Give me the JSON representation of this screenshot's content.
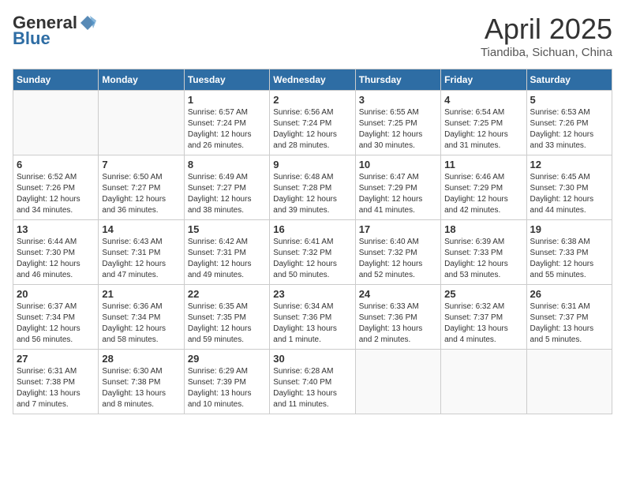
{
  "logo": {
    "general": "General",
    "blue": "Blue"
  },
  "header": {
    "month": "April 2025",
    "location": "Tiandiba, Sichuan, China"
  },
  "days_of_week": [
    "Sunday",
    "Monday",
    "Tuesday",
    "Wednesday",
    "Thursday",
    "Friday",
    "Saturday"
  ],
  "weeks": [
    [
      {
        "day": "",
        "detail": ""
      },
      {
        "day": "",
        "detail": ""
      },
      {
        "day": "1",
        "detail": "Sunrise: 6:57 AM\nSunset: 7:24 PM\nDaylight: 12 hours and 26 minutes."
      },
      {
        "day": "2",
        "detail": "Sunrise: 6:56 AM\nSunset: 7:24 PM\nDaylight: 12 hours and 28 minutes."
      },
      {
        "day": "3",
        "detail": "Sunrise: 6:55 AM\nSunset: 7:25 PM\nDaylight: 12 hours and 30 minutes."
      },
      {
        "day": "4",
        "detail": "Sunrise: 6:54 AM\nSunset: 7:25 PM\nDaylight: 12 hours and 31 minutes."
      },
      {
        "day": "5",
        "detail": "Sunrise: 6:53 AM\nSunset: 7:26 PM\nDaylight: 12 hours and 33 minutes."
      }
    ],
    [
      {
        "day": "6",
        "detail": "Sunrise: 6:52 AM\nSunset: 7:26 PM\nDaylight: 12 hours and 34 minutes."
      },
      {
        "day": "7",
        "detail": "Sunrise: 6:50 AM\nSunset: 7:27 PM\nDaylight: 12 hours and 36 minutes."
      },
      {
        "day": "8",
        "detail": "Sunrise: 6:49 AM\nSunset: 7:27 PM\nDaylight: 12 hours and 38 minutes."
      },
      {
        "day": "9",
        "detail": "Sunrise: 6:48 AM\nSunset: 7:28 PM\nDaylight: 12 hours and 39 minutes."
      },
      {
        "day": "10",
        "detail": "Sunrise: 6:47 AM\nSunset: 7:29 PM\nDaylight: 12 hours and 41 minutes."
      },
      {
        "day": "11",
        "detail": "Sunrise: 6:46 AM\nSunset: 7:29 PM\nDaylight: 12 hours and 42 minutes."
      },
      {
        "day": "12",
        "detail": "Sunrise: 6:45 AM\nSunset: 7:30 PM\nDaylight: 12 hours and 44 minutes."
      }
    ],
    [
      {
        "day": "13",
        "detail": "Sunrise: 6:44 AM\nSunset: 7:30 PM\nDaylight: 12 hours and 46 minutes."
      },
      {
        "day": "14",
        "detail": "Sunrise: 6:43 AM\nSunset: 7:31 PM\nDaylight: 12 hours and 47 minutes."
      },
      {
        "day": "15",
        "detail": "Sunrise: 6:42 AM\nSunset: 7:31 PM\nDaylight: 12 hours and 49 minutes."
      },
      {
        "day": "16",
        "detail": "Sunrise: 6:41 AM\nSunset: 7:32 PM\nDaylight: 12 hours and 50 minutes."
      },
      {
        "day": "17",
        "detail": "Sunrise: 6:40 AM\nSunset: 7:32 PM\nDaylight: 12 hours and 52 minutes."
      },
      {
        "day": "18",
        "detail": "Sunrise: 6:39 AM\nSunset: 7:33 PM\nDaylight: 12 hours and 53 minutes."
      },
      {
        "day": "19",
        "detail": "Sunrise: 6:38 AM\nSunset: 7:33 PM\nDaylight: 12 hours and 55 minutes."
      }
    ],
    [
      {
        "day": "20",
        "detail": "Sunrise: 6:37 AM\nSunset: 7:34 PM\nDaylight: 12 hours and 56 minutes."
      },
      {
        "day": "21",
        "detail": "Sunrise: 6:36 AM\nSunset: 7:34 PM\nDaylight: 12 hours and 58 minutes."
      },
      {
        "day": "22",
        "detail": "Sunrise: 6:35 AM\nSunset: 7:35 PM\nDaylight: 12 hours and 59 minutes."
      },
      {
        "day": "23",
        "detail": "Sunrise: 6:34 AM\nSunset: 7:36 PM\nDaylight: 13 hours and 1 minute."
      },
      {
        "day": "24",
        "detail": "Sunrise: 6:33 AM\nSunset: 7:36 PM\nDaylight: 13 hours and 2 minutes."
      },
      {
        "day": "25",
        "detail": "Sunrise: 6:32 AM\nSunset: 7:37 PM\nDaylight: 13 hours and 4 minutes."
      },
      {
        "day": "26",
        "detail": "Sunrise: 6:31 AM\nSunset: 7:37 PM\nDaylight: 13 hours and 5 minutes."
      }
    ],
    [
      {
        "day": "27",
        "detail": "Sunrise: 6:31 AM\nSunset: 7:38 PM\nDaylight: 13 hours and 7 minutes."
      },
      {
        "day": "28",
        "detail": "Sunrise: 6:30 AM\nSunset: 7:38 PM\nDaylight: 13 hours and 8 minutes."
      },
      {
        "day": "29",
        "detail": "Sunrise: 6:29 AM\nSunset: 7:39 PM\nDaylight: 13 hours and 10 minutes."
      },
      {
        "day": "30",
        "detail": "Sunrise: 6:28 AM\nSunset: 7:40 PM\nDaylight: 13 hours and 11 minutes."
      },
      {
        "day": "",
        "detail": ""
      },
      {
        "day": "",
        "detail": ""
      },
      {
        "day": "",
        "detail": ""
      }
    ]
  ]
}
